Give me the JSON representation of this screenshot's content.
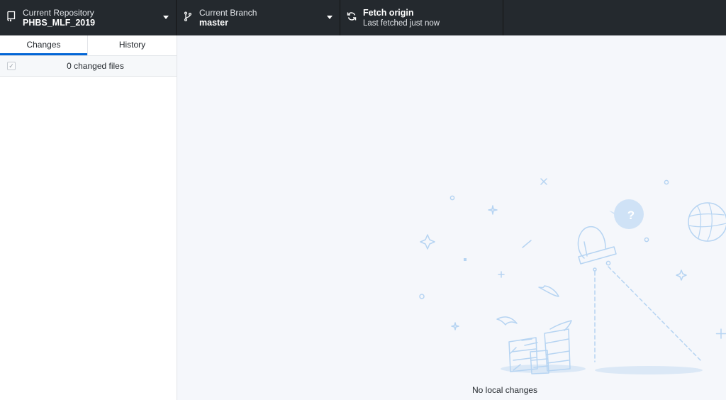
{
  "toolbar": {
    "repository": {
      "label": "Current Repository",
      "value": "PHBS_MLF_2019",
      "icon": "repo-icon"
    },
    "branch": {
      "label": "Current Branch",
      "value": "master",
      "icon": "git-branch-icon"
    },
    "fetch": {
      "label": "Fetch origin",
      "status": "Last fetched just now",
      "icon": "sync-icon"
    }
  },
  "sidebar": {
    "tabs": [
      {
        "label": "Changes",
        "selected": true
      },
      {
        "label": "History",
        "selected": false
      }
    ],
    "changed_files_label": "0 changed files",
    "select_all_checked": true
  },
  "main": {
    "empty_message": "No local changes"
  },
  "colors": {
    "toolbar_bg": "#24292e",
    "accent": "#0366d6",
    "illustration": "#b6d4f2",
    "main_bg": "#f5f7fb"
  }
}
